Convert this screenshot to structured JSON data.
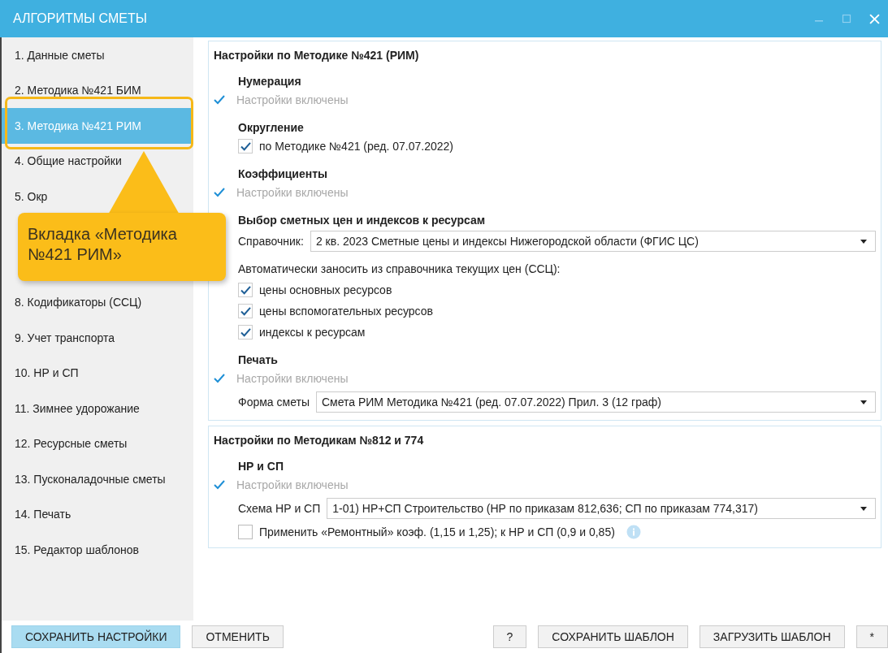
{
  "window": {
    "title": "АЛГОРИТМЫ СМЕТЫ"
  },
  "sidebar": {
    "items": [
      {
        "label": "1. Данные сметы",
        "selected": false
      },
      {
        "label": "2. Методика №421 БИМ",
        "selected": false
      },
      {
        "label": "3. Методика №421 РИМ",
        "selected": true
      },
      {
        "label": "4. Общие настройки",
        "selected": false
      },
      {
        "label": "5. Окр",
        "selected": false
      },
      {
        "label": "8. Кодификаторы (ССЦ)",
        "selected": false
      },
      {
        "label": "9. Учет транспорта",
        "selected": false
      },
      {
        "label": "10. НР и СП",
        "selected": false
      },
      {
        "label": "11. Зимнее удорожание",
        "selected": false
      },
      {
        "label": "12. Ресурсные сметы",
        "selected": false
      },
      {
        "label": "13. Пусконаладочные сметы",
        "selected": false
      },
      {
        "label": "14. Печать",
        "selected": false
      },
      {
        "label": "15. Редактор шаблонов",
        "selected": false
      }
    ]
  },
  "callout": {
    "text": "Вкладка «Методика №421 РИМ»"
  },
  "panels": [
    {
      "title": "Настройки по Методике №421 (РИМ)",
      "groups": [
        {
          "heading": "Нумерация",
          "rows": [
            {
              "kind": "enabled",
              "label": "Настройки включены"
            }
          ]
        },
        {
          "heading": "Округление",
          "rows": [
            {
              "kind": "checkbox",
              "checked": true,
              "label": "по Методике №421 (ред. 07.07.2022)"
            }
          ]
        },
        {
          "heading": "Коэффициенты",
          "rows": [
            {
              "kind": "enabled",
              "label": "Настройки включены"
            }
          ]
        },
        {
          "heading": "Выбор сметных цен и индексов к ресурсам",
          "rows": [
            {
              "kind": "select",
              "label": "Справочник:",
              "value": "2 кв. 2023 Сметные цены и индексы Нижегородской области (ФГИС ЦС)"
            },
            {
              "kind": "text",
              "label": "Автоматически заносить из справочника текущих цен (ССЦ):"
            },
            {
              "kind": "checkbox",
              "checked": true,
              "label": "цены основных ресурсов"
            },
            {
              "kind": "checkbox",
              "checked": true,
              "label": "цены вспомогательных ресурсов"
            },
            {
              "kind": "checkbox",
              "checked": true,
              "label": "индексы к ресурсам"
            }
          ]
        },
        {
          "heading": "Печать",
          "rows": [
            {
              "kind": "enabled",
              "label": "Настройки включены"
            },
            {
              "kind": "select",
              "label": "Форма сметы",
              "value": "Смета РИМ Методика №421 (ред. 07.07.2022) Прил. 3 (12 граф)"
            }
          ]
        }
      ]
    },
    {
      "title": "Настройки по Методикам №812 и 774",
      "groups": [
        {
          "heading": "НР и СП",
          "rows": [
            {
              "kind": "enabled",
              "label": "Настройки включены"
            },
            {
              "kind": "select",
              "label": "Схема НР и СП",
              "value": "1-01) НР+СП Строительство (НР по приказам 812,636; СП по приказам 774,317)"
            },
            {
              "kind": "checkbox",
              "checked": false,
              "label": "Применить «Ремонтный» коэф. (1,15 и 1,25); к НР и СП (0,9 и 0,85)",
              "info": true
            }
          ]
        }
      ]
    }
  ],
  "footer": {
    "left": [
      {
        "label": "СОХРАНИТЬ НАСТРОЙКИ",
        "highlighted": true
      },
      {
        "label": "ОТМЕНИТЬ",
        "highlighted": false
      }
    ],
    "right": [
      {
        "label": "?",
        "highlighted": false
      },
      {
        "label": "СОХРАНИТЬ ШАБЛОН",
        "highlighted": false
      },
      {
        "label": "ЗАГРУЗИТЬ ШАБЛОН",
        "highlighted": false
      },
      {
        "label": "*",
        "highlighted": false
      }
    ]
  }
}
